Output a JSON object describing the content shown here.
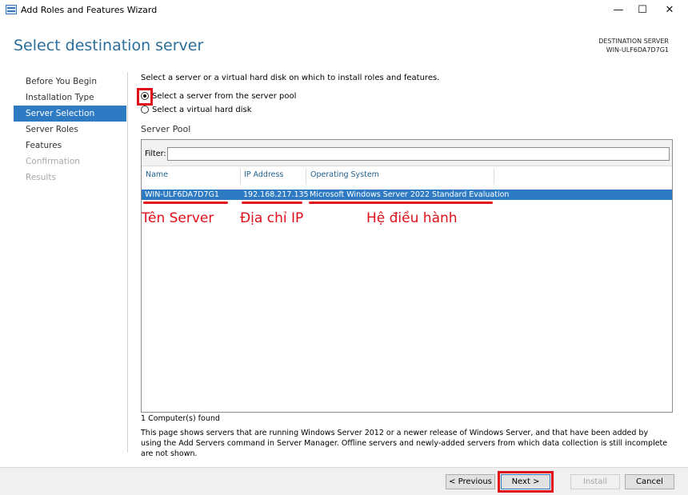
{
  "window": {
    "title": "Add Roles and Features Wizard",
    "minimize": "—",
    "maximize": "☐",
    "close": "✕"
  },
  "header": {
    "page_title": "Select destination server",
    "dest_label": "DESTINATION SERVER",
    "dest_value": "WIN-ULF6DA7D7G1"
  },
  "nav": {
    "items": [
      {
        "label": "Before You Begin",
        "state": "normal"
      },
      {
        "label": "Installation Type",
        "state": "normal"
      },
      {
        "label": "Server Selection",
        "state": "active"
      },
      {
        "label": "Server Roles",
        "state": "normal"
      },
      {
        "label": "Features",
        "state": "normal"
      },
      {
        "label": "Confirmation",
        "state": "disabled"
      },
      {
        "label": "Results",
        "state": "disabled"
      }
    ]
  },
  "main": {
    "intro": "Select a server or a virtual hard disk on which to install roles and features.",
    "option_pool": "Select a server from the server pool",
    "option_vhd": "Select a virtual hard disk",
    "pool_title": "Server Pool",
    "filter_label": "Filter:",
    "filter_value": "",
    "columns": [
      "Name",
      "IP Address",
      "Operating System"
    ],
    "rows": [
      {
        "name": "WIN-ULF6DA7D7G1",
        "ip": "192.168.217.135",
        "os": "Microsoft Windows Server 2022 Standard Evaluation"
      }
    ],
    "annotations": {
      "name": "Tên Server",
      "ip": "Địa chỉ IP",
      "os": "Hệ điều hành"
    },
    "count": "1 Computer(s) found",
    "description": "This page shows servers that are running Windows Server 2012 or a newer release of Windows Server, and that have been added by using the Add Servers command in Server Manager. Offline servers and newly-added servers from which data collection is still incomplete are not shown."
  },
  "footer": {
    "previous": "< Previous",
    "next": "Next >",
    "install": "Install",
    "cancel": "Cancel"
  },
  "colors": {
    "accent": "#2e7bc4",
    "title": "#2a6f9c",
    "highlight": "#e0101a"
  }
}
